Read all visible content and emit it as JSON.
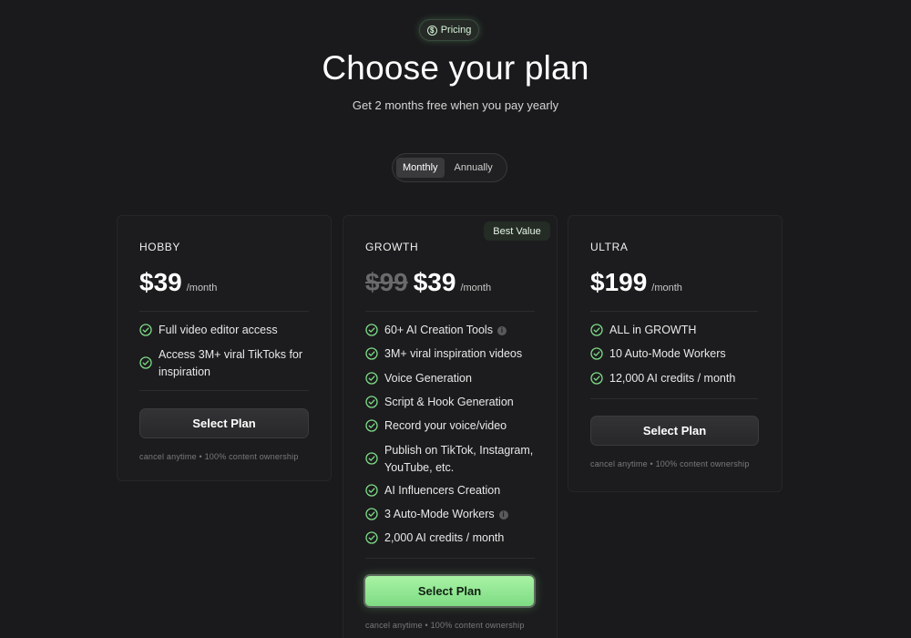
{
  "header": {
    "pill_label": "Pricing",
    "pill_icon": "dollar-circle-icon",
    "title": "Choose your plan",
    "subtitle": "Get 2 months free when you pay yearly"
  },
  "billing_toggle": {
    "options": [
      "Monthly",
      "Annually"
    ],
    "selected": "Monthly"
  },
  "plans": [
    {
      "name": "HOBBY",
      "price": "$39",
      "period": "/month",
      "features": [
        "Full video editor access",
        "Access 3M+ viral TikToks for inspiration"
      ],
      "button_label": "Select Plan",
      "note": "cancel anytime • 100% content ownership"
    },
    {
      "name": "GROWTH",
      "badge": "Best Value",
      "old_price": "$99",
      "price": "$39",
      "period": "/month",
      "features": [
        "60+ AI Creation Tools",
        "3M+ viral inspiration videos",
        "Voice Generation",
        "Script & Hook Generation",
        "Record your voice/video",
        "Publish on TikTok, Instagram, YouTube, etc.",
        "AI Influencers Creation",
        "3 Auto-Mode Workers",
        "2,000 AI credits / month"
      ],
      "button_label": "Select Plan",
      "note": "cancel anytime • 100% content ownership"
    },
    {
      "name": "ULTRA",
      "price": "$199",
      "period": "/month",
      "features": [
        "ALL in GROWTH",
        "10 Auto-Mode Workers",
        "12,000 AI credits / month"
      ],
      "button_label": "Select Plan",
      "note": "cancel anytime • 100% content ownership"
    }
  ],
  "colors": {
    "background": "#1a1a1c",
    "accent_green": "#8ee58c",
    "check_green": "#7fdc88"
  }
}
